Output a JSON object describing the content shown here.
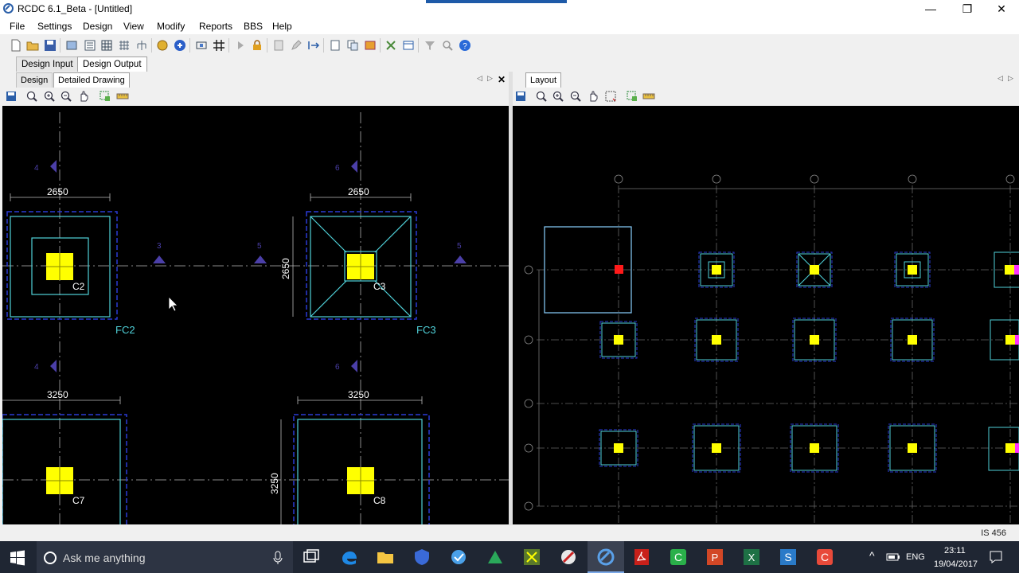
{
  "window": {
    "title": "RCDC 6.1_Beta - [Untitled]",
    "minimize": "—",
    "restore": "❐",
    "close": "✕"
  },
  "menu": [
    "File",
    "Settings",
    "Design",
    "View",
    "Modify",
    "Reports",
    "BBS",
    "Help"
  ],
  "top_tabs": {
    "input": "Design Input",
    "output": "Design Output"
  },
  "left_panel": {
    "tabs": {
      "design": "Design",
      "detailed": "Detailed Drawing"
    },
    "nav_prev": "◁",
    "nav_next": "▷",
    "close": "✕",
    "drawing": {
      "footings": [
        {
          "dim_top": "2650",
          "col": "C2",
          "tag": "FC2"
        },
        {
          "dim_top": "2650",
          "dim_side": "2650",
          "col": "C3",
          "tag": "FC3"
        },
        {
          "dim_top": "3250",
          "col": "C7"
        },
        {
          "dim_top": "3250",
          "dim_side": "3250",
          "col": "C8"
        }
      ],
      "section_marks": [
        "4",
        "6",
        "3",
        "5",
        "5",
        "4",
        "6"
      ]
    }
  },
  "right_panel": {
    "tab": "Layout",
    "nav_prev": "◁",
    "nav_next": "▷"
  },
  "status": {
    "code": "IS 456"
  },
  "taskbar": {
    "search_placeholder": "Ask me anything",
    "lang": "ENG",
    "time": "23:11",
    "date": "19/04/2017",
    "tray_chevron": "^"
  },
  "colors": {
    "canvas": "#000000",
    "footing_outline": "#4fd1d9",
    "dashed": "#2a3bd6",
    "column": "#ffff00",
    "dim_text": "#ffffff",
    "section_mark": "#4b3fa8",
    "taskbar": "#1f2633"
  }
}
